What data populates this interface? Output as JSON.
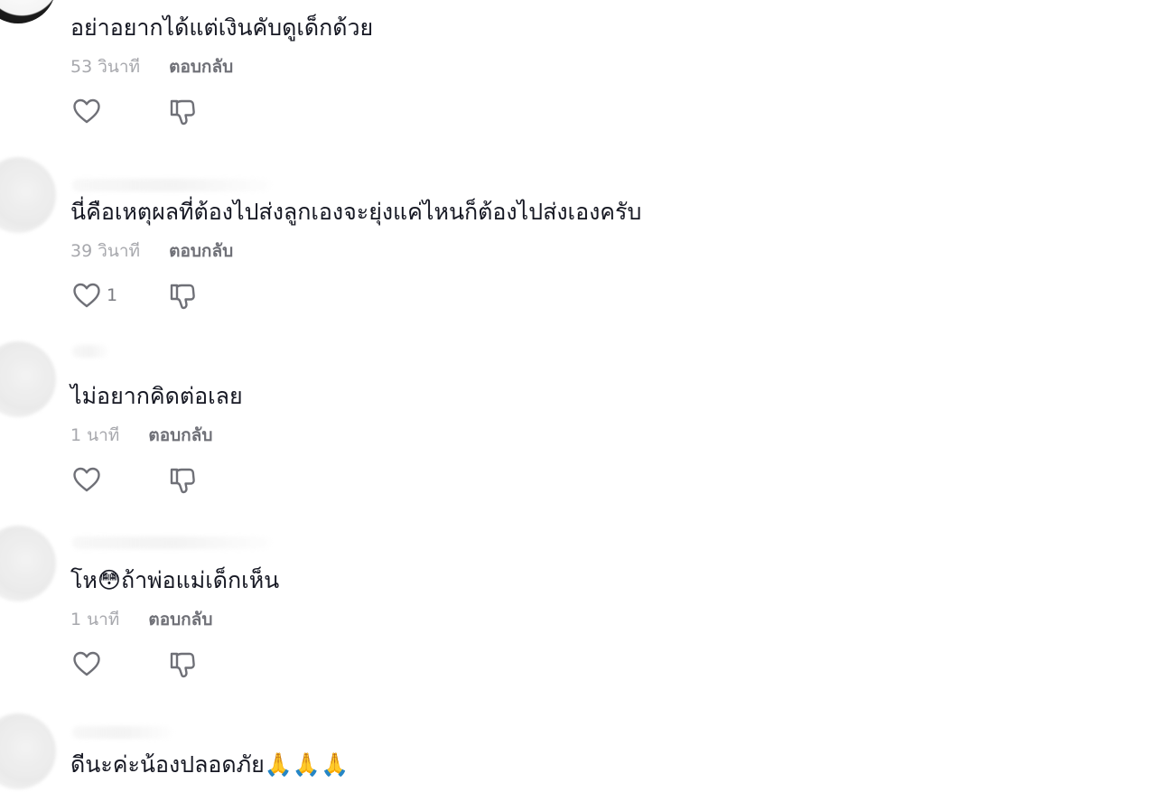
{
  "comments": [
    {
      "text": "อย่าอยากได้แต่เงินคับดูเด็กด้วย",
      "time": "53 วินาที",
      "reply_label": "ตอบกลับ",
      "like_count": "",
      "like_icon": "heart-outline-icon",
      "dislike_icon": "thumbs-down-icon"
    },
    {
      "text": "นี่คือเหตุผลที่ต้องไปส่งลูกเองจะยุ่งแค่ไหนก็ต้องไปส่งเองครับ",
      "time": "39 วินาที",
      "reply_label": "ตอบกลับ",
      "like_count": "1",
      "like_icon": "heart-outline-icon",
      "dislike_icon": "thumbs-down-icon"
    },
    {
      "text": "ไม่อยากคิดต่อเลย",
      "time": "1 นาที",
      "reply_label": "ตอบกลับ",
      "like_count": "",
      "like_icon": "heart-outline-icon",
      "dislike_icon": "thumbs-down-icon"
    },
    {
      "text": "โห😳ถ้าพ่อแม่เด็กเห็น",
      "time": "1 นาที",
      "reply_label": "ตอบกลับ",
      "like_count": "",
      "like_icon": "heart-outline-icon",
      "dislike_icon": "thumbs-down-icon"
    },
    {
      "text": "ดีนะค่ะน้องปลอดภัย🙏🙏🙏",
      "time": "",
      "reply_label": "",
      "like_count": "",
      "like_icon": "heart-outline-icon",
      "dislike_icon": "thumbs-down-icon"
    }
  ],
  "colors": {
    "text": "#161823",
    "time": "#a7a8ad",
    "reply": "#6f7077",
    "icon": "#6f7077"
  }
}
